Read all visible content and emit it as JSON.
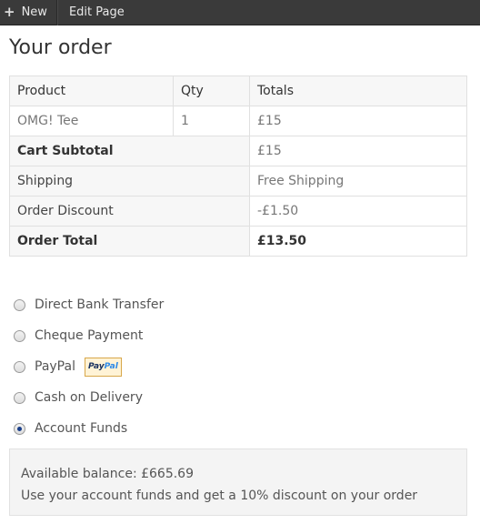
{
  "adminbar": {
    "new_label": "New",
    "edit_label": "Edit Page"
  },
  "page": {
    "title": "Your order"
  },
  "order_table": {
    "headers": {
      "product": "Product",
      "qty": "Qty",
      "totals": "Totals"
    },
    "item": {
      "product": "OMG! Tee",
      "qty": "1",
      "total": "£15"
    },
    "subtotal": {
      "label": "Cart Subtotal",
      "value": "£15"
    },
    "shipping": {
      "label": "Shipping",
      "value": "Free Shipping"
    },
    "discount": {
      "label": "Order Discount",
      "value": "-£1.50"
    },
    "total": {
      "label": "Order Total",
      "value": "£13.50"
    }
  },
  "payment_methods": [
    {
      "label": "Direct Bank Transfer",
      "selected": false
    },
    {
      "label": "Cheque Payment",
      "selected": false
    },
    {
      "label": "PayPal",
      "selected": false,
      "badge": {
        "part1": "Pay",
        "part2": "Pal"
      }
    },
    {
      "label": "Cash on Delivery",
      "selected": false
    },
    {
      "label": "Account Funds",
      "selected": true
    }
  ],
  "funds_box": {
    "balance": "Available balance: £665.69",
    "message": "Use your account funds and get a 10% discount on your order"
  },
  "colors": {
    "adminbar_bg": "#3a3a3a",
    "paypal_dark": "#17305f",
    "paypal_light": "#2c8ae8"
  }
}
